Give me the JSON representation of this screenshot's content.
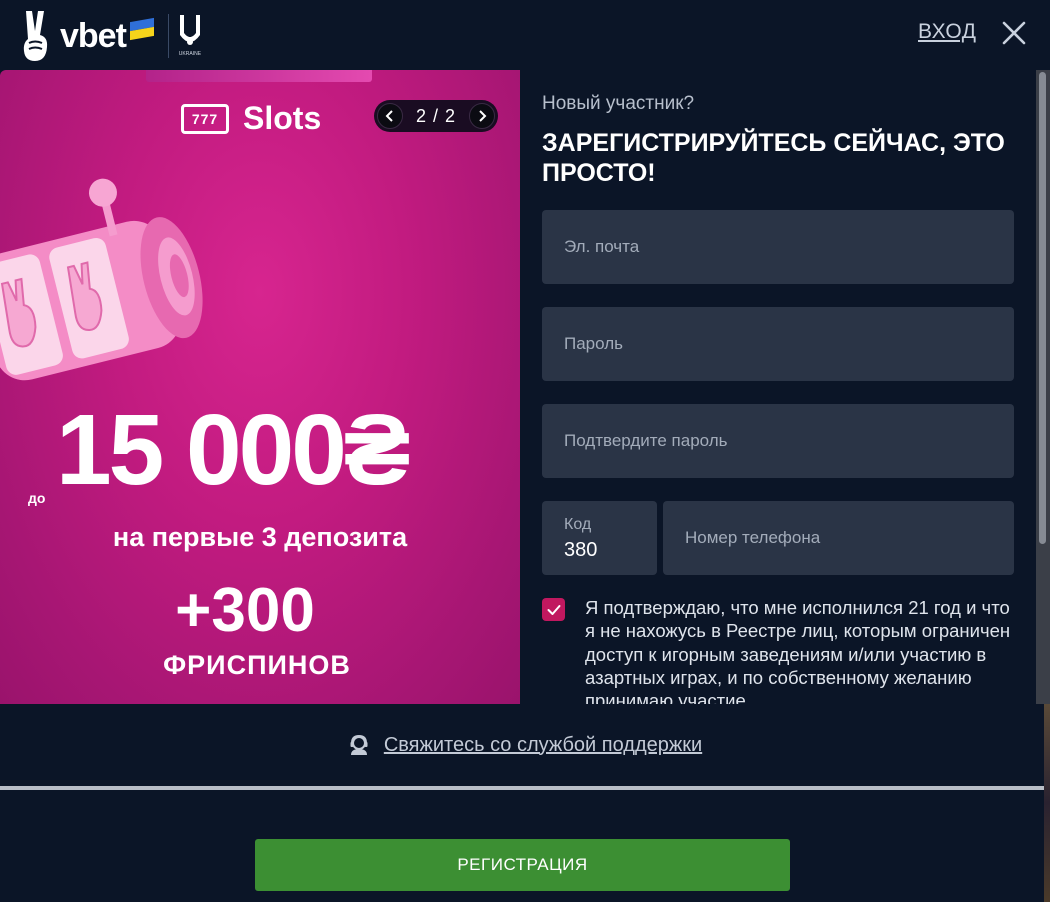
{
  "header": {
    "brand": "vbet",
    "crest_caption": "UKRAINE",
    "login_label": "ВХОД"
  },
  "promo": {
    "category": "Slots",
    "slots_icon_text": "777",
    "pager": "2 / 2",
    "bonus_prefix": "до",
    "bonus_amount": "15 000₴",
    "bonus_desc": "на первые 3 депозита",
    "spins": "+300",
    "spins_label": "ФРИСПИНОВ"
  },
  "form": {
    "subtitle": "Новый участник?",
    "title": "ЗАРЕГИСТРИРУЙТЕСЬ СЕЙЧАС, ЭТО ПРОСТО!",
    "email_placeholder": "Эл. почта",
    "password_placeholder": "Пароль",
    "confirm_placeholder": "Подтвердите пароль",
    "code_label": "Код",
    "code_value": "380",
    "phone_placeholder": "Номер телефона",
    "consent_checked": true,
    "consent_text": "Я подтверждаю, что мне исполнился 21 год и что я не нахожусь в Реестре лиц, которым ограничен доступ к игорным заведениям и/или участию в азартных играх, и по собственному желанию принимаю участие"
  },
  "support": {
    "link_label": "Свяжитесь со службой поддержки"
  },
  "footer": {
    "register_label": "РЕГИСТРАЦИЯ"
  },
  "colors": {
    "background": "#0b1527",
    "field": "#2a3446",
    "promo": "#c21b80",
    "checkbox": "#c1185f",
    "register": "#3c8f33"
  }
}
